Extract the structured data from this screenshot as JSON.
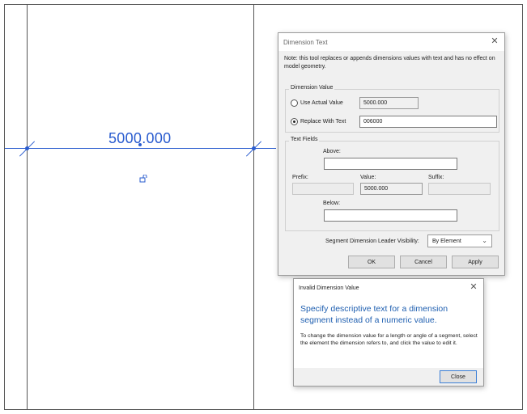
{
  "canvas": {
    "dimension_value": "5000.000",
    "line_color": "#2a5ccf"
  },
  "dimension_text_dialog": {
    "title": "Dimension Text",
    "close_icon": "close-icon",
    "note": "Note: this tool replaces or appends dimensions values with text and has no effect on model geometry.",
    "dimension_value_group": {
      "label": "Dimension Value",
      "use_actual_label": "Use Actual Value",
      "use_actual_value": "5000.000",
      "use_actual_selected": false,
      "replace_label": "Replace With Text",
      "replace_value": "006000",
      "replace_selected": true
    },
    "text_fields_group": {
      "label": "Text Fields",
      "above_label": "Above:",
      "above_value": "",
      "prefix_label": "Prefix:",
      "prefix_value": "",
      "value_label": "Value:",
      "value_value": "5000.000",
      "suffix_label": "Suffix:",
      "suffix_value": "",
      "below_label": "Below:",
      "below_value": ""
    },
    "leader_visibility": {
      "label": "Segment Dimension Leader Visibility:",
      "selected": "By Element"
    },
    "buttons": {
      "ok": "OK",
      "cancel": "Cancel",
      "apply": "Apply"
    }
  },
  "invalid_dialog": {
    "title": "Invalid Dimension Value",
    "heading": "Specify descriptive text for a dimension segment instead of a numeric value.",
    "body": "To change the dimension value for a length or angle of a segment, select the element the dimension refers to, and click the value to edit it.",
    "close_button": "Close",
    "heading_color": "#1f5fb0"
  }
}
